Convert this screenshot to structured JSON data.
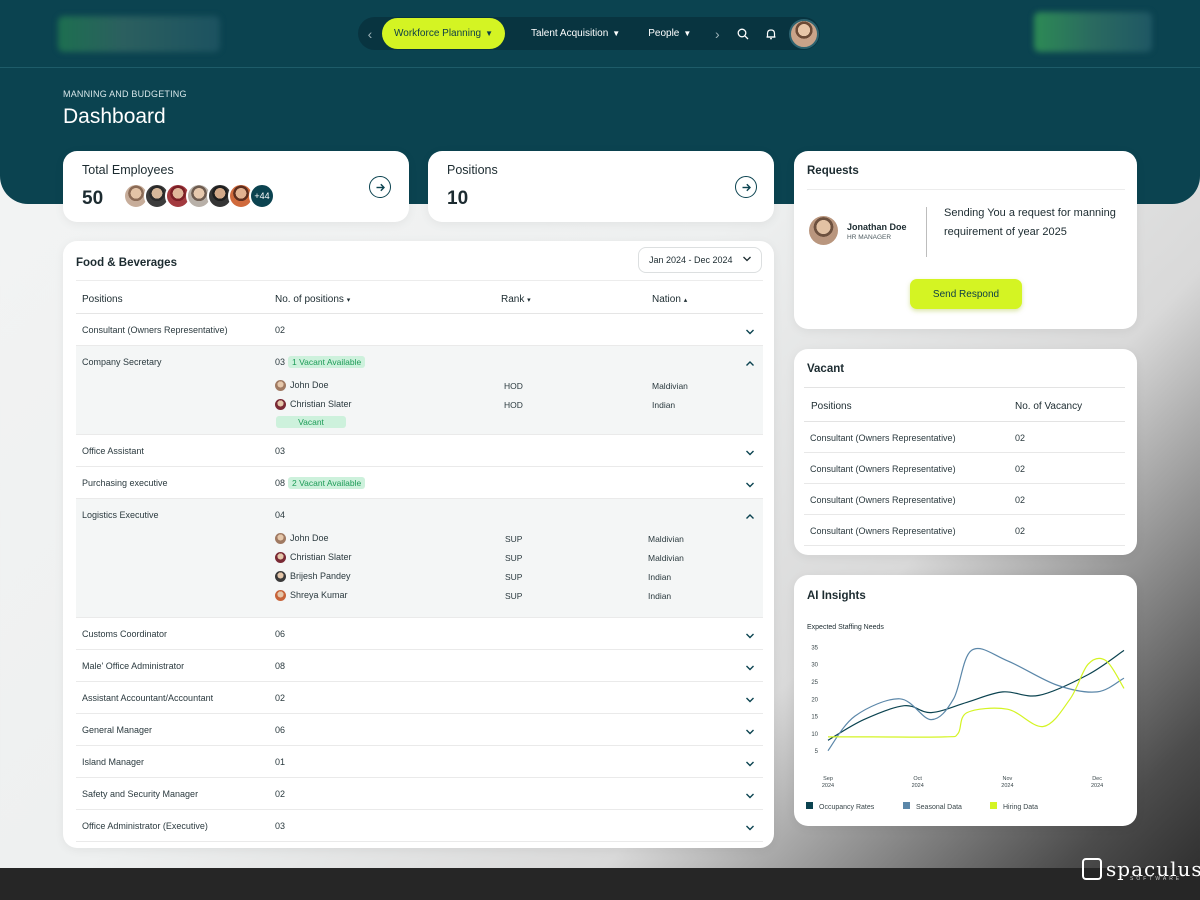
{
  "nav": {
    "items": [
      {
        "label": "Workforce Planning",
        "active": true
      },
      {
        "label": "Talent Acquisition",
        "active": false
      },
      {
        "label": "People",
        "active": false
      }
    ],
    "prev_icon": "chevron-left-icon",
    "next_icon": "chevron-right-icon",
    "search_icon": "search-icon",
    "bell_icon": "bell-icon"
  },
  "page": {
    "breadcrumb": "MANNING AND BUDGETING",
    "title": "Dashboard"
  },
  "stats": {
    "total_employees": {
      "label": "Total Employees",
      "value": "50",
      "more": "+44"
    },
    "positions": {
      "label": "Positions",
      "value": "10"
    }
  },
  "department": {
    "title": "Food & Beverages",
    "date_range": "Jan 2024 - Dec 2024",
    "columns": [
      "Positions",
      "No. of positions",
      "Rank",
      "Nation"
    ],
    "column_sort": [
      "",
      "▾",
      "▾",
      "▴"
    ],
    "rows": [
      {
        "position": "Consultant (Owners Representative)",
        "count": "02",
        "badge": "",
        "expanded": false,
        "members": []
      },
      {
        "position": "Company Secretary",
        "count": "03",
        "badge": "1 Vacant Available",
        "expanded": true,
        "vacant_label": "Vacant",
        "members": [
          {
            "name": "John Doe",
            "rank": "HOD",
            "nation": "Maldivian"
          },
          {
            "name": "Christian Slater",
            "rank": "HOD",
            "nation": "Indian"
          }
        ]
      },
      {
        "position": "Office Assistant",
        "count": "03",
        "badge": "",
        "expanded": false,
        "members": []
      },
      {
        "position": "Purchasing executive",
        "count": "08",
        "badge": "2 Vacant Available",
        "expanded": false,
        "members": []
      },
      {
        "position": "Logistics Executive",
        "count": "04",
        "badge": "",
        "expanded": true,
        "members": [
          {
            "name": "John Doe",
            "rank": "SUP",
            "nation": "Maldivian"
          },
          {
            "name": "Christian Slater",
            "rank": "SUP",
            "nation": "Maldivian"
          },
          {
            "name": "Brijesh Pandey",
            "rank": "SUP",
            "nation": "Indian"
          },
          {
            "name": "Shreya Kumar",
            "rank": "SUP",
            "nation": "Indian"
          }
        ]
      },
      {
        "position": "Customs Coordinator",
        "count": "06",
        "badge": "",
        "expanded": false,
        "members": []
      },
      {
        "position": "Male' Office Administrator",
        "count": "08",
        "badge": "",
        "expanded": false,
        "members": []
      },
      {
        "position": "Assistant Accountant/Accountant",
        "count": "02",
        "badge": "",
        "expanded": false,
        "members": []
      },
      {
        "position": "General Manager",
        "count": "06",
        "badge": "",
        "expanded": false,
        "members": []
      },
      {
        "position": "Island Manager",
        "count": "01",
        "badge": "",
        "expanded": false,
        "members": []
      },
      {
        "position": "Safety and Security Manager",
        "count": "02",
        "badge": "",
        "expanded": false,
        "members": []
      },
      {
        "position": "Office Administrator (Executive)",
        "count": "03",
        "badge": "",
        "expanded": false,
        "members": []
      }
    ]
  },
  "requests": {
    "title": "Requests",
    "name": "Jonathan Doe",
    "role": "HR MANAGER",
    "message": "Sending You a request for manning requirement of year 2025",
    "button": "Send Respond"
  },
  "vacant": {
    "title": "Vacant",
    "columns": [
      "Positions",
      "No. of Vacancy"
    ],
    "rows": [
      {
        "position": "Consultant (Owners Representative)",
        "count": "02"
      },
      {
        "position": "Consultant (Owners Representative)",
        "count": "02"
      },
      {
        "position": "Consultant (Owners Representative)",
        "count": "02"
      },
      {
        "position": "Consultant (Owners Representative)",
        "count": "02"
      }
    ]
  },
  "insights": {
    "title": "AI Insights",
    "subtitle": "Expected Staffing Needs"
  },
  "chart_data": {
    "type": "line",
    "title": "Expected Staffing Needs",
    "xlabel": "",
    "ylabel": "",
    "x_ticks": [
      {
        "label": "Sep\n2024",
        "x": 0
      },
      {
        "label": "Oct\n2024",
        "x": 1
      },
      {
        "label": "Nov\n2024",
        "x": 2
      },
      {
        "label": "Dec\n2024",
        "x": 3
      }
    ],
    "xlim": [
      0,
      3.3
    ],
    "ylim": [
      0,
      37
    ],
    "y_ticks": [
      5,
      10,
      15,
      20,
      25,
      30,
      35
    ],
    "series": [
      {
        "name": "Occupancy Rates",
        "color": "#0b4350",
        "points": [
          [
            0,
            8
          ],
          [
            0.4,
            14
          ],
          [
            0.85,
            18
          ],
          [
            1.15,
            16
          ],
          [
            1.55,
            19
          ],
          [
            1.95,
            22
          ],
          [
            2.35,
            21
          ],
          [
            2.9,
            27
          ],
          [
            3.3,
            34
          ]
        ]
      },
      {
        "name": "Seasonal Data",
        "color": "#5b87a9",
        "points": [
          [
            0,
            5
          ],
          [
            0.3,
            15
          ],
          [
            0.8,
            20
          ],
          [
            1.15,
            14
          ],
          [
            1.4,
            20
          ],
          [
            1.6,
            34
          ],
          [
            2.0,
            31
          ],
          [
            2.55,
            24
          ],
          [
            3.0,
            22
          ],
          [
            3.3,
            26
          ]
        ]
      },
      {
        "name": "Hiring Data",
        "color": "#d4f423",
        "points": [
          [
            0,
            9
          ],
          [
            0.5,
            9
          ],
          [
            1.3,
            9
          ],
          [
            1.45,
            10
          ],
          [
            1.55,
            16
          ],
          [
            2.0,
            17
          ],
          [
            2.4,
            12
          ],
          [
            2.7,
            20
          ],
          [
            2.9,
            30
          ],
          [
            3.1,
            31
          ],
          [
            3.3,
            23
          ]
        ]
      }
    ],
    "legend": "bottom",
    "grid": false
  },
  "brand": {
    "name": "spaculus",
    "tagline": "SOFTWARE"
  }
}
